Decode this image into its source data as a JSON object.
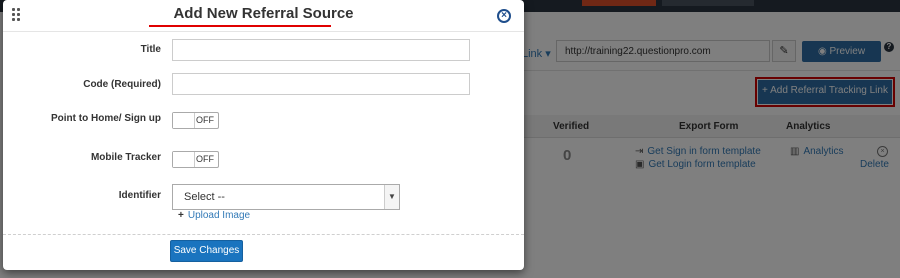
{
  "modal": {
    "title": "Add New Referral Source",
    "fields": {
      "title_label": "Title",
      "title_value": "",
      "code_label": "Code (Required)",
      "code_value": "",
      "point_label": "Point to Home/ Sign up",
      "point_state": "OFF",
      "mobile_label": "Mobile Tracker",
      "mobile_state": "OFF",
      "identifier_label": "Identifier",
      "identifier_selected": "Select --",
      "upload_label": "Upload Image"
    },
    "save_label": "Save Changes"
  },
  "background": {
    "link_label": "Link",
    "url": "http://training22.questionpro.com",
    "preview_label": "Preview",
    "help": "?",
    "add_button_label": "Add Referral Tracking Link",
    "table_headers": {
      "verified": "Verified",
      "export_form": "Export Form",
      "analytics": "Analytics"
    },
    "row": {
      "verified": "0",
      "signin_link": "Get Sign in form template",
      "login_link": "Get Login form template",
      "analytics_link": "Analytics",
      "delete_link": "Delete"
    }
  },
  "colors": {
    "accent": "#1a74bf",
    "highlight": "#d10000",
    "overlay": "rgba(0,0,0,0.5)"
  }
}
